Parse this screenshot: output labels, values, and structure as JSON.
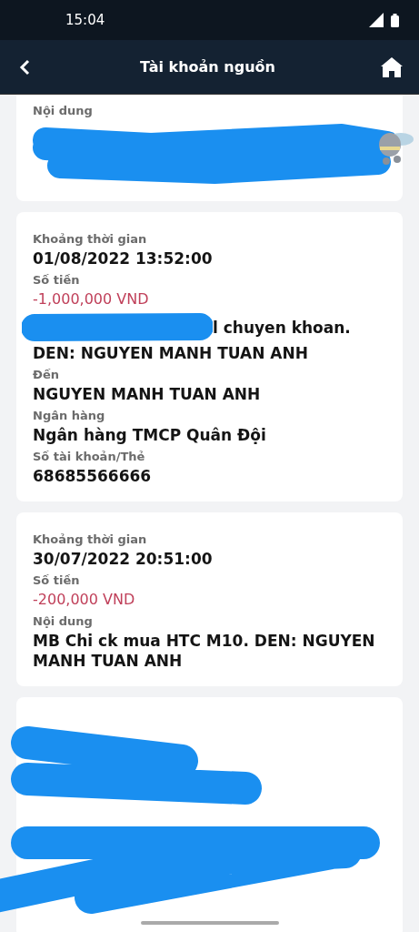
{
  "status_bar": {
    "time": "15:04"
  },
  "header": {
    "title": "Tài khoản nguồn"
  },
  "cards": [
    {
      "cut_top": true,
      "mascot": true,
      "redacted": false,
      "fields": [
        {
          "kind": "hidden_value",
          "label": "Nội dung"
        }
      ]
    },
    {
      "cut_top": false,
      "mascot": false,
      "redacted": false,
      "fields": [
        {
          "kind": "text",
          "label": "Khoảng thời gian",
          "lines": [
            "01/08/2022 13:52:00"
          ]
        },
        {
          "kind": "amount",
          "label": "Số tiền",
          "lines": [
            "-1,000,000 VND"
          ]
        },
        {
          "kind": "hidden_start",
          "lines": [
            "l chuyen khoan.",
            "DEN: NGUYEN MANH TUAN ANH"
          ]
        },
        {
          "kind": "text",
          "label": "Đến",
          "lines": [
            "NGUYEN MANH TUAN ANH"
          ]
        },
        {
          "kind": "text",
          "label": "Ngân hàng",
          "lines": [
            "Ngân hàng TMCP Quân Đội"
          ]
        },
        {
          "kind": "text",
          "label": "Số tài khoản/Thẻ",
          "lines": [
            "68685566666"
          ]
        }
      ]
    },
    {
      "cut_top": false,
      "mascot": false,
      "redacted": false,
      "fields": [
        {
          "kind": "text",
          "label": "Khoảng thời gian",
          "lines": [
            "30/07/2022 20:51:00"
          ]
        },
        {
          "kind": "amount",
          "label": "Số tiền",
          "lines": [
            "-200,000 VND"
          ]
        },
        {
          "kind": "text",
          "label": "Nội dung",
          "lines": [
            "MB Chi ck mua HTC M10. DEN: NGUYEN MANH TUAN ANH"
          ]
        }
      ]
    },
    {
      "cut_top": false,
      "mascot": false,
      "redacted": true
    }
  ]
}
